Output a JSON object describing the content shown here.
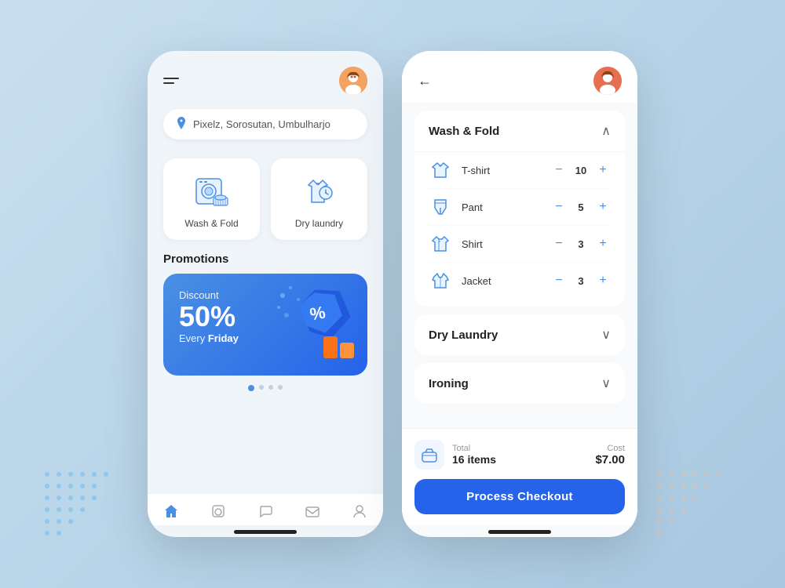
{
  "background": {
    "color": "#c2d9ed"
  },
  "leftPhone": {
    "topBar": {
      "avatar_alt": "User avatar"
    },
    "location": {
      "text": "Pixelz, Sorosutan, Umbulharjo"
    },
    "services": [
      {
        "id": "wash-fold",
        "label": "Wash & Fold"
      },
      {
        "id": "dry-laundry",
        "label": "Dry laundry"
      }
    ],
    "promotions": {
      "sectionTitle": "Promotions",
      "card": {
        "discount_label": "Discount",
        "percent": "50%",
        "sub_text": "Every ",
        "sub_bold": "Friday"
      }
    },
    "bottomNav": [
      {
        "id": "home",
        "label": "Home",
        "active": true
      },
      {
        "id": "laundry",
        "label": "Laundry"
      },
      {
        "id": "chat",
        "label": "Chat"
      },
      {
        "id": "mail",
        "label": "Mail"
      },
      {
        "id": "profile",
        "label": "Profile"
      }
    ]
  },
  "rightPhone": {
    "backBtn": "←",
    "categories": [
      {
        "id": "wash-fold",
        "title": "Wash & Fold",
        "expanded": true,
        "chevron": "∧",
        "items": [
          {
            "id": "tshirt",
            "name": "T-shirt",
            "qty": 10,
            "icon": "👕"
          },
          {
            "id": "pant",
            "name": "Pant",
            "qty": 5,
            "icon": "👖"
          },
          {
            "id": "shirt",
            "name": "Shirt",
            "qty": 3,
            "icon": "👔"
          },
          {
            "id": "jacket",
            "name": "Jacket",
            "qty": 3,
            "icon": "🧥"
          }
        ]
      },
      {
        "id": "dry-laundry",
        "title": "Dry Laundry",
        "expanded": false,
        "chevron": "∨",
        "items": []
      },
      {
        "id": "ironing",
        "title": "Ironing",
        "expanded": false,
        "chevron": "∨",
        "items": []
      }
    ],
    "checkout": {
      "total_label": "Total",
      "total_items": "16 items",
      "cost_label": "Cost",
      "cost_value": "$7.00",
      "btn_label": "Process Checkout"
    }
  }
}
